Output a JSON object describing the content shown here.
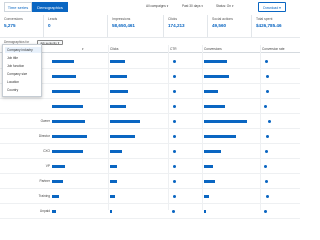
{
  "tabs": [
    {
      "label": "Time series",
      "active": false
    },
    {
      "label": "Demographics",
      "active": true
    }
  ],
  "filters": {
    "campaigns": "All campaigns",
    "date_range": "Past 30 days",
    "status": "Status: On"
  },
  "download_label": "Download",
  "metrics": [
    {
      "label": "Conversions",
      "value": "5,275"
    },
    {
      "label": "Leads",
      "value": "0"
    },
    {
      "label": "Impressions",
      "value": "58,650,461"
    },
    {
      "label": "Clicks",
      "value": "174,213"
    },
    {
      "label": "Social actions",
      "value": "49,560"
    },
    {
      "label": "Total spent",
      "value": "$426,785.46"
    }
  ],
  "controls": {
    "label": "Demographics for",
    "select_value": "Job seniority"
  },
  "table": {
    "headers": [
      "Clicks",
      "CTR",
      "Conversions",
      "Conversion rate"
    ],
    "rows": [
      {
        "label": "",
        "spend": 0.2,
        "clicks": 0.12,
        "ctr": 0.05,
        "conv": 0.2,
        "rate": 0.05
      },
      {
        "label": "",
        "spend": 0.22,
        "clicks": 0.14,
        "ctr": 0.06,
        "conv": 0.22,
        "rate": 0.07
      },
      {
        "label": "",
        "spend": 0.25,
        "clicks": 0.15,
        "ctr": 0.05,
        "conv": 0.12,
        "rate": 0.06
      },
      {
        "label": "",
        "spend": 0.28,
        "clicks": 0.13,
        "ctr": 0.05,
        "conv": 0.18,
        "rate": 0.04
      },
      {
        "label": "Owner",
        "spend": 0.3,
        "clicks": 0.25,
        "ctr": 0.06,
        "conv": 0.38,
        "rate": 0.1
      },
      {
        "label": "Director",
        "spend": 0.32,
        "clicks": 0.21,
        "ctr": 0.05,
        "conv": 0.28,
        "rate": 0.06
      },
      {
        "label": "CXO",
        "spend": 0.28,
        "clicks": 0.1,
        "ctr": 0.05,
        "conv": 0.15,
        "rate": 0.05
      },
      {
        "label": "VP",
        "spend": 0.12,
        "clicks": 0.06,
        "ctr": 0.05,
        "conv": 0.08,
        "rate": 0.04
      },
      {
        "label": "Partner",
        "spend": 0.1,
        "clicks": 0.06,
        "ctr": 0.06,
        "conv": 0.1,
        "rate": 0.05
      },
      {
        "label": "Training",
        "spend": 0.06,
        "clicks": 0.04,
        "ctr": 0.05,
        "conv": 0.04,
        "rate": 0.06
      },
      {
        "label": "Unpaid",
        "spend": 0.04,
        "clicks": 0.02,
        "ctr": 0.04,
        "conv": 0.02,
        "rate": 0.03
      }
    ]
  },
  "dropdown_options": [
    "Company industry",
    "Job title",
    "Job function",
    "Company size",
    "Location",
    "Country"
  ],
  "colors": {
    "accent": "#0a66c2"
  }
}
